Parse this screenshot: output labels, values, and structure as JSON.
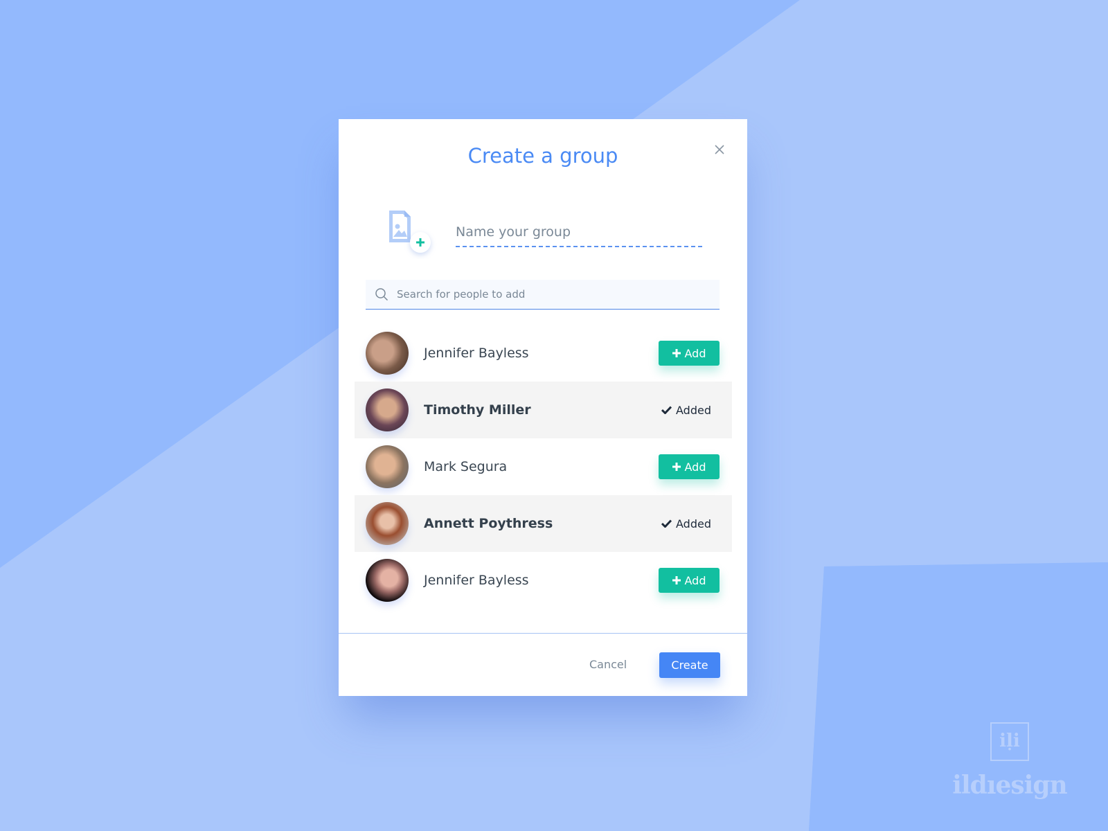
{
  "background": {
    "colors": {
      "primary": "#93b9fd",
      "light": "#a9c6fb"
    }
  },
  "modal": {
    "title": "Create a group",
    "close_label": "Close",
    "group_name": {
      "value": "",
      "placeholder": "Name your group"
    },
    "search": {
      "value": "",
      "placeholder": "Search for people to add"
    },
    "people": [
      {
        "name": "Jennifer Bayless",
        "status": "add",
        "action_label": "Add"
      },
      {
        "name": "Timothy Miller",
        "status": "added",
        "action_label": "Added"
      },
      {
        "name": "Mark Segura",
        "status": "add",
        "action_label": "Add"
      },
      {
        "name": "Annett Poythress",
        "status": "added",
        "action_label": "Added"
      },
      {
        "name": "Jennifer Bayless",
        "status": "add",
        "action_label": "Add"
      }
    ],
    "footer": {
      "cancel_label": "Cancel",
      "create_label": "Create"
    }
  },
  "colors": {
    "accent": "#4a8af4",
    "add_green": "#12bfa0",
    "create_blue": "#4586f5"
  },
  "watermark": {
    "mark": "iḷi",
    "text": "ildıesign"
  }
}
